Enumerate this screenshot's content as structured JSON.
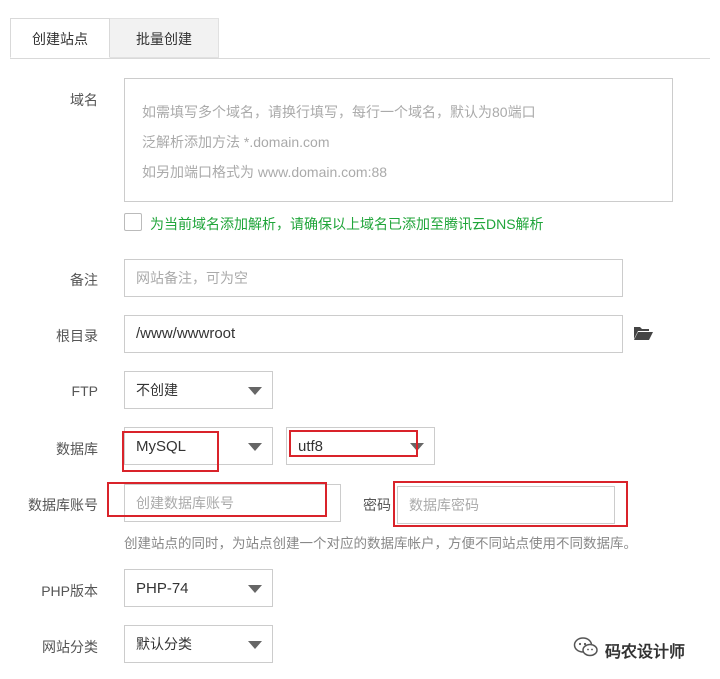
{
  "tabs": [
    {
      "label": "创建站点",
      "active": true
    },
    {
      "label": "批量创建",
      "active": false
    }
  ],
  "domain": {
    "label": "域名",
    "placeholder_lines": [
      "如需填写多个域名，请换行填写，每行一个域名，默认为80端口",
      "泛解析添加方法 *.domain.com",
      "如另加端口格式为 www.domain.com:88"
    ],
    "dns_checkbox_label": "为当前域名添加解析，请确保以上域名已添加至腾讯云DNS解析",
    "dns_checked": false
  },
  "remark": {
    "label": "备注",
    "placeholder": "网站备注，可为空"
  },
  "root": {
    "label": "根目录",
    "value": "/www/wwwroot"
  },
  "ftp": {
    "label": "FTP",
    "selected": "不创建"
  },
  "database": {
    "label": "数据库",
    "type": "MySQL",
    "charset": "utf8"
  },
  "db_account": {
    "label": "数据库账号",
    "placeholder": "创建数据库账号",
    "password_label": "密码",
    "password_placeholder": "数据库密码",
    "hint": "创建站点的同时，为站点创建一个对应的数据库帐户，方便不同站点使用不同数据库。"
  },
  "php": {
    "label": "PHP版本",
    "selected": "PHP-74"
  },
  "category": {
    "label": "网站分类",
    "selected": "默认分类"
  },
  "watermark": {
    "text": "码农设计师"
  },
  "colors": {
    "accent_green": "#20a53a",
    "highlight_red": "#d9232a",
    "border": "#cccccc"
  }
}
